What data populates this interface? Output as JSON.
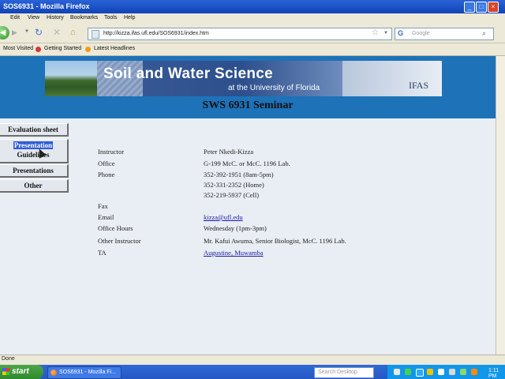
{
  "window": {
    "title": "SOS6931 - Mozilla Firefox"
  },
  "menu": [
    "File",
    "Edit",
    "View",
    "History",
    "Bookmarks",
    "Tools",
    "Help"
  ],
  "nav": {
    "url": "http://kizza.ifas.ufl.edu/SOS6931/index.htm",
    "search_placeholder": "Google",
    "search_engine_letter": "G"
  },
  "bookmarks": [
    "Most Visited",
    "Getting Started",
    "Latest Headlines"
  ],
  "banner": {
    "title": "Soil and Water Science",
    "subtitle": "at the University of Florida",
    "logo": "IFAS"
  },
  "page_title": "SWS 6931 Seminar",
  "sidebar": {
    "items": [
      {
        "label": "Evaluation sheet"
      },
      {
        "label_line1": "Presentation",
        "label_line2": "Guidelines",
        "selected": true
      },
      {
        "label": "Presentations"
      },
      {
        "label": "Other"
      }
    ]
  },
  "info": {
    "rows": [
      {
        "label": "Instructor",
        "value": "Peter Nkedi-Kizza"
      },
      {
        "label": "Office",
        "value": "G-199 McC. or McC. 1196 Lab."
      },
      {
        "label": "Phone",
        "values": [
          "352-392-1951 (8am-5pm)",
          "352-331-2352 (Home)",
          "352-219-5937 (Cell)"
        ]
      },
      {
        "label": "Fax",
        "value": ""
      },
      {
        "label": "Email",
        "value": "kizza@ufl.edu",
        "link": true
      },
      {
        "label": "Office Hours",
        "value": "Wednesday (1pm-3pm)"
      },
      {
        "label": "Other Instructor",
        "value": "Mr. Kafui Awuma, Senior Biologist, McC. 1196 Lab."
      },
      {
        "label": "TA",
        "value": "Augustine, Muwamba",
        "link": true
      }
    ]
  },
  "statusbar": {
    "text": "Done"
  },
  "taskbar": {
    "start": "start",
    "task": "SOS6931 - Mozilla Fi...",
    "search_placeholder": "Search Desktop",
    "clock": "1:11 PM"
  },
  "colors": {
    "header_band": "#1d72b8",
    "page_bg": "#e9eef4",
    "link": "#1a1aa8",
    "titlebar": "#2a63d6"
  }
}
